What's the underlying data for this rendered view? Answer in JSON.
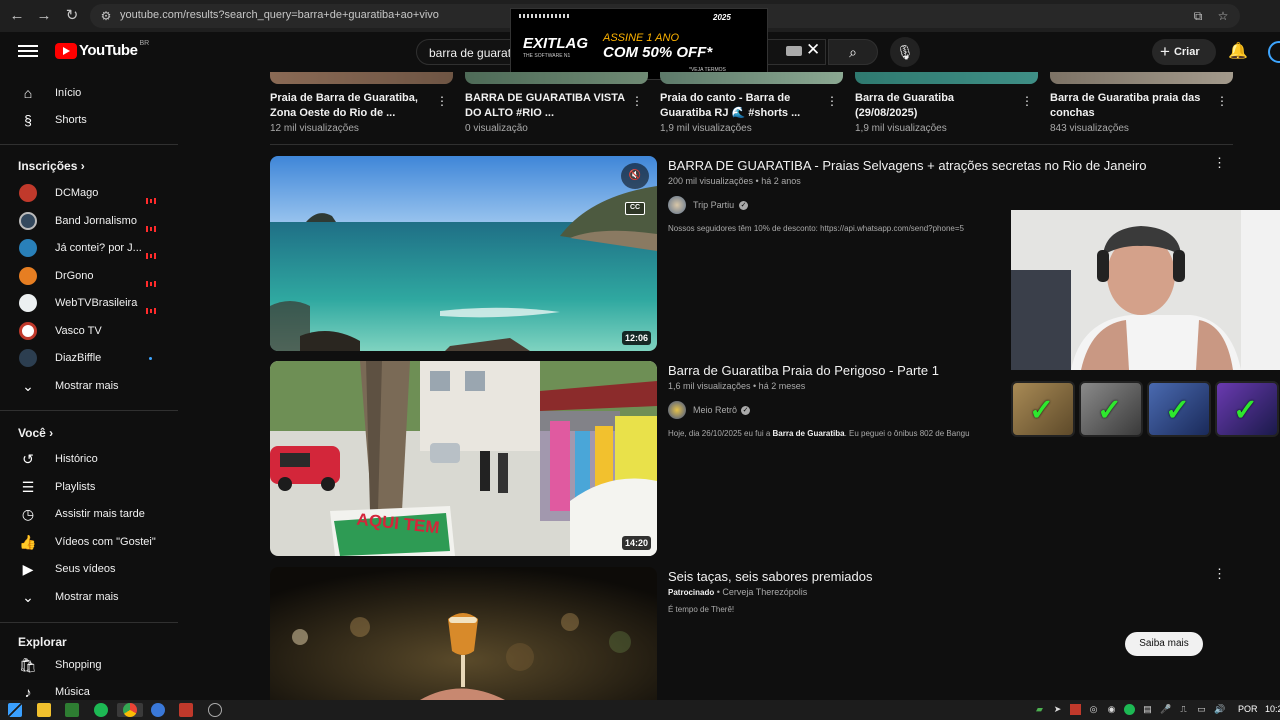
{
  "browser": {
    "url": "youtube.com/results?search_query=barra+de+guaratiba+ao+vivo"
  },
  "header": {
    "logo_text": "YouTube",
    "country": "BR",
    "search_value": "barra de guarat",
    "create_label": "Criar"
  },
  "ad": {
    "brand": "EXITLAG",
    "brand_sub": "THE SOFTWARE N1",
    "line1": "ASSINE 1 ANO",
    "line2": "COM 50% OFF*",
    "note": "*VEJA TERMOS",
    "year": "2025"
  },
  "sidebar": {
    "main": [
      {
        "label": "Início",
        "icon": "home-icon"
      },
      {
        "label": "Shorts",
        "icon": "shorts-icon"
      }
    ],
    "subs_title": "Inscrições",
    "subs": [
      {
        "label": "DCMago",
        "color": "#c0392b",
        "live": true
      },
      {
        "label": "Band Jornalismo",
        "color": "#8e44ad",
        "live": true
      },
      {
        "label": "Já contei? por J...",
        "color": "#2980b9",
        "live": true
      },
      {
        "label": "DrGono",
        "color": "#e67e22",
        "live": true
      },
      {
        "label": "WebTVBrasileira",
        "color": "#ecf0f1",
        "live": true
      },
      {
        "label": "Vasco TV",
        "color": "#c0392b",
        "live": false
      },
      {
        "label": "DiazBiffle",
        "color": "#2c3e50",
        "live": false,
        "new": true
      }
    ],
    "subs_more": "Mostrar mais",
    "you_title": "Você",
    "you": [
      {
        "label": "Histórico",
        "icon": "history-icon"
      },
      {
        "label": "Playlists",
        "icon": "playlists-icon"
      },
      {
        "label": "Assistir mais tarde",
        "icon": "watch-later-icon"
      },
      {
        "label": "Vídeos com \"Gostei\"",
        "icon": "like-icon"
      },
      {
        "label": "Seus vídeos",
        "icon": "your-videos-icon"
      }
    ],
    "you_more": "Mostrar mais",
    "explore_title": "Explorar",
    "explore": [
      {
        "label": "Shopping",
        "icon": "shopping-icon"
      },
      {
        "label": "Música",
        "icon": "music-icon"
      }
    ]
  },
  "shorts": [
    {
      "title": "Praia de Barra de Guaratiba, Zona Oeste do Rio de ...",
      "views": "12 mil visualizações"
    },
    {
      "title": "BARRA DE GUARATIBA VISTA DO ALTO #RIO ...",
      "views": "0 visualização"
    },
    {
      "title": "Praia do canto - Barra de Guaratiba RJ 🌊 #shorts ...",
      "views": "1,9 mil visualizações"
    },
    {
      "title": "Barra de Guaratiba (29/08/2025)",
      "views": "1,9 mil visualizações"
    },
    {
      "title": "Barra de Guaratiba praia das conchas",
      "views": "843 visualizações"
    }
  ],
  "videos": [
    {
      "title": "BARRA DE GUARATIBA - Praias Selvagens + atrações secretas no Rio de Janeiro",
      "meta": "200 mil visualizações • há 2 anos",
      "channel": "Trip Partiu",
      "desc": "Nossos seguidores têm 10% de desconto: https://api.whatsapp.com/send?phone=5",
      "duration": "12:06"
    },
    {
      "title": "Barra de Guaratiba Praia do Perigoso - Parte 1",
      "meta": "1,6 mil visualizações • há 2 meses",
      "channel": "Meio Retrô",
      "desc_pre": "Hoje, dia 26/10/2025 eu fui a ",
      "desc_bold": "Barra de Guaratiba",
      "desc_post": ". Eu peguei o ônibus 802 de Bangu",
      "duration": "14:20",
      "thumb_text": "AQUI TEM"
    },
    {
      "title": "Seis taças, seis sabores premiados",
      "sponsored": "Patrocinado",
      "channel": "Cerveja Therezópolis",
      "desc": "É tempo de Therê!",
      "cta": "Saiba mais"
    }
  ],
  "taskbar": {
    "lang": "POR",
    "time": "10:2"
  }
}
